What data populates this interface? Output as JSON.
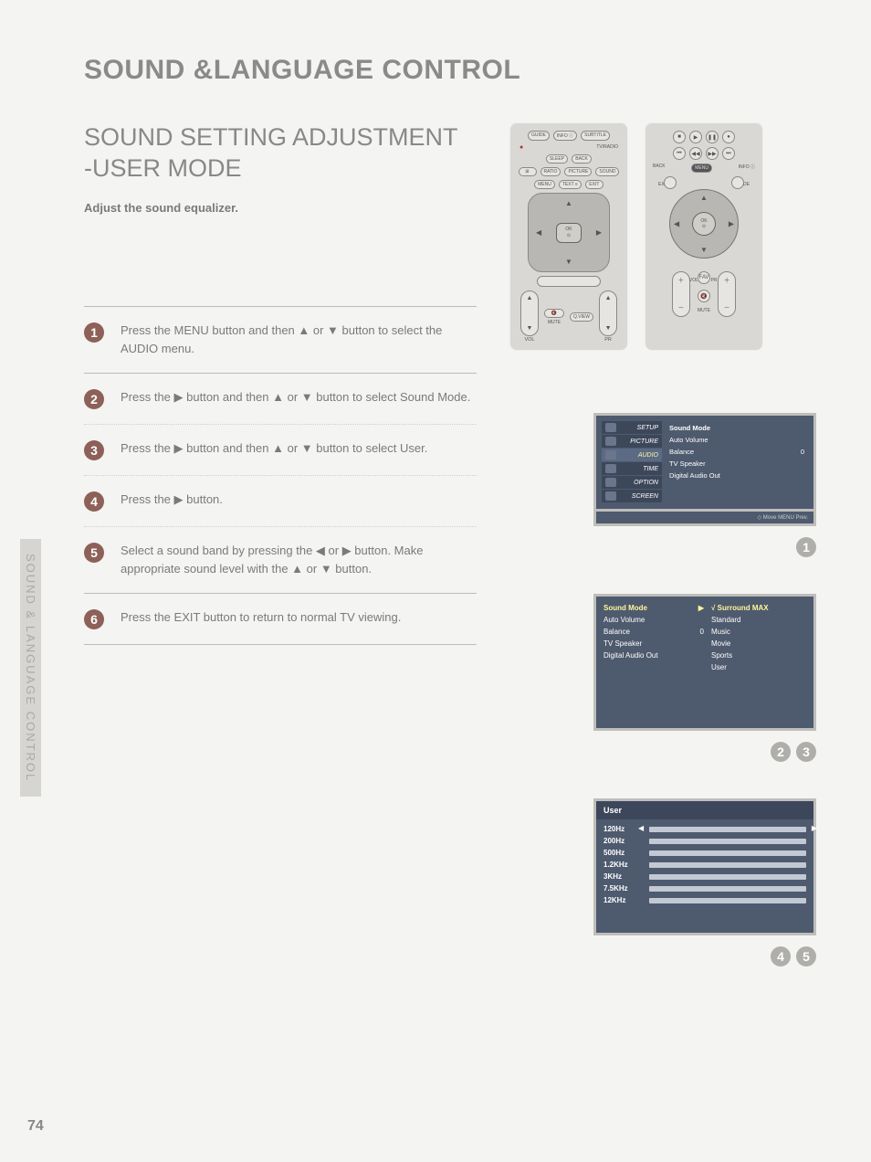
{
  "page_number": "74",
  "side_tab": "SOUND & LANGUAGE CONTROL",
  "main_title": "SOUND &LANGUAGE CONTROL",
  "sub_title_line1": "SOUND SETTING ADJUSTMENT",
  "sub_title_line2": "-USER MODE",
  "intro": "Adjust the sound equalizer.",
  "steps": {
    "s1": "Press the MENU button and then ▲ or ▼ button to select the AUDIO menu.",
    "s2": "Press the ▶ button and then ▲ or ▼ button to select Sound Mode.",
    "s3": "Press the ▶ button and then ▲ or ▼ button to select User.",
    "s4": "Press the ▶ button.",
    "s5": "Select a sound band by pressing the ◀ or ▶ button. Make appropriate sound level with the ▲ or ▼ button.",
    "s6": "Press the EXIT button to return to normal TV viewing."
  },
  "remote1": {
    "top_row": [
      "GUIDE",
      "INFO ⓘ",
      "SUBTITLE"
    ],
    "red_label": "●",
    "tvr": "TV/RADIO",
    "sleep": "SLEEP",
    "back": "BACK",
    "pip": "⊞",
    "ratio": "RATIO",
    "picture": "PICTURE",
    "sound": "SOUND",
    "menu": "MENU",
    "text": "TEXT ≡",
    "exit": "EXIT",
    "ok": "OK",
    "vol": "VOL",
    "pr": "PR",
    "mute_btn": "🔇",
    "qview": "Q.VIEW",
    "mute": "MUTE"
  },
  "remote2": {
    "row1": [
      "■",
      "▶",
      "❚❚",
      "●"
    ],
    "row2": [
      "⏮",
      "◀◀",
      "▶▶",
      "⏭"
    ],
    "back": "BACK",
    "menu": "MENU",
    "info": "INFO ⓘ",
    "exit": "EXIT",
    "guide": "GUIDE",
    "ok": "OK",
    "vol": "VOL",
    "pr": "PR",
    "fav": "FAV",
    "mute": "🔇",
    "mute_lbl": "MUTE"
  },
  "osd1": {
    "tabs": [
      "SETUP",
      "PICTURE",
      "AUDIO",
      "TIME",
      "OPTION",
      "SCREEN"
    ],
    "items": [
      {
        "label": "Sound Mode",
        "val": ""
      },
      {
        "label": "Auto Volume",
        "val": ""
      },
      {
        "label": "Balance",
        "val": "0"
      },
      {
        "label": "TV Speaker",
        "val": ""
      },
      {
        "label": "Digital Audio Out",
        "val": ""
      }
    ],
    "footer": "◇ Move   MENU  Prev."
  },
  "osd2": {
    "left": [
      {
        "label": "Sound Mode",
        "val": "▶",
        "hl": true
      },
      {
        "label": "Auto Volume",
        "val": ""
      },
      {
        "label": "Balance",
        "val": "0"
      },
      {
        "label": "TV Speaker",
        "val": ""
      },
      {
        "label": "Digital Audio Out",
        "val": ""
      }
    ],
    "right": [
      "√ Surround MAX",
      "   Standard",
      "   Music",
      "   Movie",
      "   Sports",
      "   User"
    ]
  },
  "osd3": {
    "title": "User",
    "bands": [
      "120Hz",
      "200Hz",
      "500Hz",
      "1.2KHz",
      "3KHz",
      "7.5KHz",
      "12KHz"
    ]
  },
  "badges": {
    "b1": "1",
    "b2": "2",
    "b3": "3",
    "b4": "4",
    "b5": "5"
  }
}
